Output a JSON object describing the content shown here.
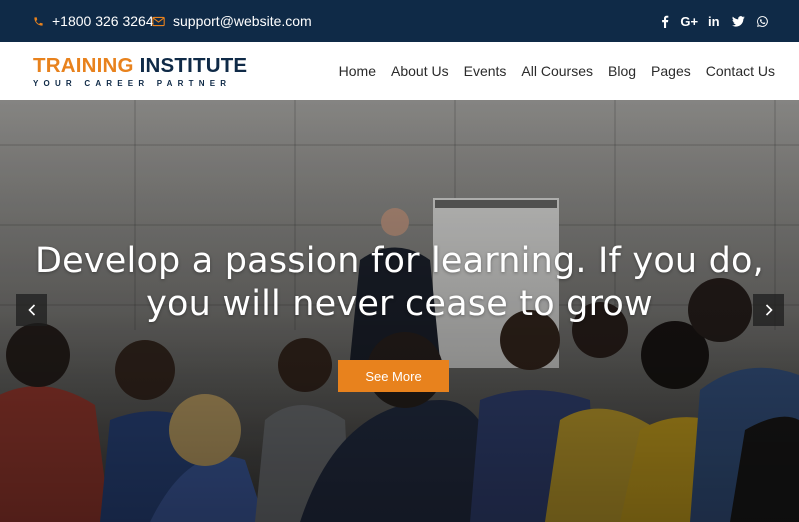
{
  "topbar": {
    "phone": "+1800 326 3264",
    "email": "support@website.com",
    "socials": [
      {
        "name": "facebook-icon",
        "glyph": "f"
      },
      {
        "name": "google-plus-icon",
        "glyph": "G+"
      },
      {
        "name": "linkedin-icon",
        "glyph": "in"
      },
      {
        "name": "twitter-icon",
        "glyph": "t"
      },
      {
        "name": "whatsapp-icon",
        "glyph": "w"
      }
    ],
    "accent": "#e8821d",
    "background": "#0f2a47"
  },
  "logo": {
    "part1": "TRAINING",
    "part2": "INSTITUTE",
    "tagline": "YOUR CAREER PARTNER"
  },
  "nav": {
    "items": [
      "Home",
      "About Us",
      "Events",
      "All Courses",
      "Blog",
      "Pages",
      "Contact Us"
    ]
  },
  "hero": {
    "headline_line1": "Develop a passion for learning. If you do,",
    "headline_line2": "you will never cease to grow",
    "cta_label": "See More",
    "cta_color": "#e8821d"
  }
}
